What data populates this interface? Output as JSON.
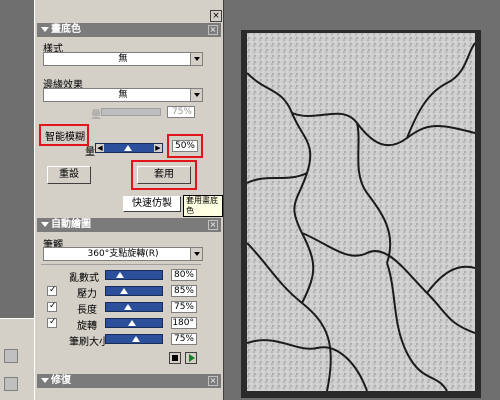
{
  "panel": {
    "section1": {
      "title": "畫底色",
      "style_label": "樣式",
      "style_value": "無",
      "edge_label": "邊緣效果",
      "edge_value": "無",
      "grain_label": "量",
      "grain_value": "75%",
      "smart_blur_label": "智能模糊",
      "blur_slider_label": "量",
      "blur_value": "50%",
      "reset_label": "重設",
      "apply_label": "套用",
      "tooltip": "套用畫底色",
      "quick_clone_label": "快速仿製"
    },
    "section2": {
      "title": "自動繪圖",
      "brush_label": "筆觸",
      "brush_value": "360°支點旋轉(R)",
      "params": [
        {
          "label": "亂數式",
          "value": "80%",
          "checked": null
        },
        {
          "label": "壓力",
          "value": "85%",
          "checked": true
        },
        {
          "label": "長度",
          "value": "75%",
          "checked": true
        },
        {
          "label": "旋轉",
          "value": "180°",
          "checked": true
        },
        {
          "label": "筆刷大小",
          "value": "75%",
          "checked": null
        }
      ]
    },
    "section3": {
      "title": "修復"
    }
  },
  "colors": {
    "accent_red": "#e0141a",
    "slider_blue": "#2b4f9a",
    "panel_bg": "#d4d0c8",
    "workspace_bg": "#6f6f6f"
  },
  "icons": {
    "collapse": "triangle-down-icon",
    "close": "close-icon",
    "play": "play-icon",
    "stop": "stop-icon"
  }
}
